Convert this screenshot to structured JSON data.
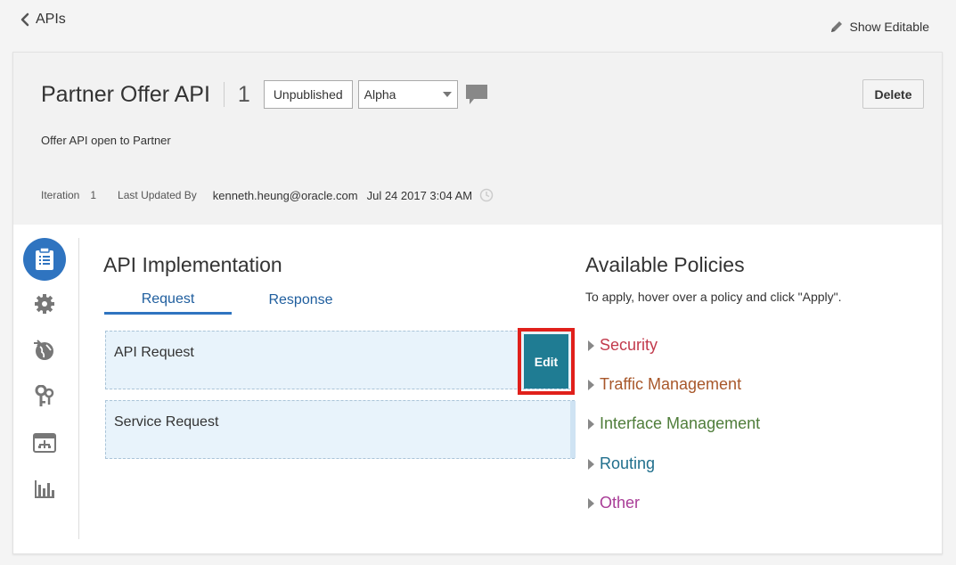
{
  "nav": {
    "back_label": "APIs",
    "show_editable_label": "Show Editable"
  },
  "header": {
    "api_name": "Partner Offer API",
    "version": "1",
    "status_label": "Unpublished",
    "stage_select": {
      "selected": "Alpha"
    },
    "delete_label": "Delete",
    "description": "Offer API open to Partner",
    "iteration_label": "Iteration",
    "iteration_value": "1",
    "last_updated_label": "Last Updated By",
    "last_updated_user": "kenneth.heung@oracle.com",
    "last_updated_date": "Jul 24 2017 3:04 AM"
  },
  "side_nav": {
    "items": [
      "implementation-icon",
      "settings-icon",
      "globe-icon",
      "keys-icon",
      "deployment-icon",
      "analytics-icon"
    ]
  },
  "implementation": {
    "title": "API Implementation",
    "tabs": [
      {
        "label": "Request"
      },
      {
        "label": "Response"
      }
    ],
    "blocks": [
      {
        "label": "API Request"
      },
      {
        "label": "Service Request"
      }
    ],
    "edit_label": "Edit"
  },
  "policies": {
    "title": "Available Policies",
    "hint": "To apply, hover over a policy and click \"Apply\".",
    "items": [
      {
        "label": "Security",
        "color": "#c23a4c"
      },
      {
        "label": "Traffic Management",
        "color": "#a8572a"
      },
      {
        "label": "Interface Management",
        "color": "#4f7d3a"
      },
      {
        "label": "Routing",
        "color": "#1f6e8c"
      },
      {
        "label": "Other",
        "color": "#a93d97"
      }
    ]
  }
}
